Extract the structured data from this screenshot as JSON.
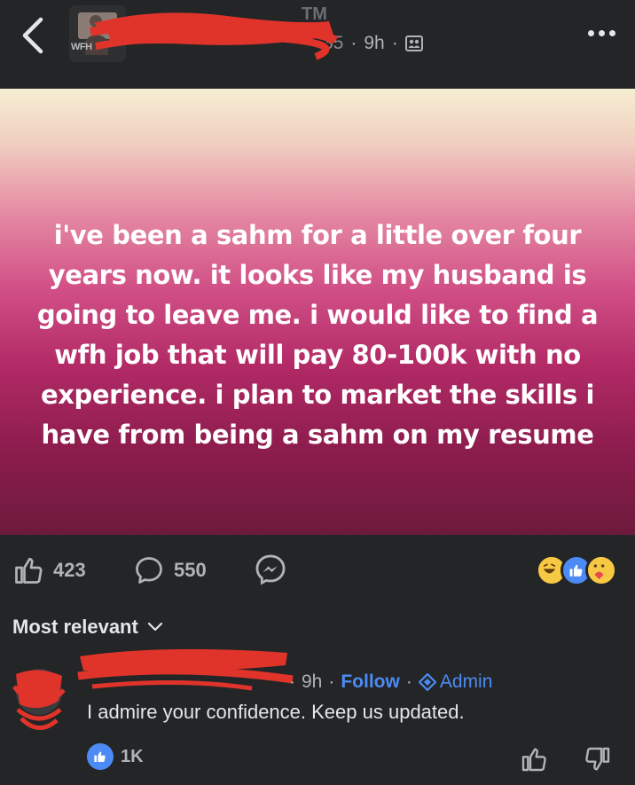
{
  "header": {
    "avatar_label": "WFH",
    "faint_text": "TM",
    "meta_partial": "35",
    "time": "9h",
    "separator": "·"
  },
  "post": {
    "text": "i've been a sahm for a little over four years now. it looks like my husband is going to leave me. i would like to find a wfh job that will pay 80-100k with no experience. i plan to market the skills i have from being a sahm on my resume",
    "likes": "423",
    "comments": "550",
    "reaction_icons": [
      "laugh-emoji",
      "like-emoji",
      "care-emoji"
    ]
  },
  "sort": {
    "label": "Most relevant"
  },
  "comment": {
    "time": "9h",
    "follow_label": "Follow",
    "admin_label": "Admin",
    "text": "I admire your confidence. Keep us updated.",
    "like_count": "1K"
  },
  "colors": {
    "background": "#242526",
    "accent": "#4c8bf5",
    "redaction": "#e0342b"
  }
}
